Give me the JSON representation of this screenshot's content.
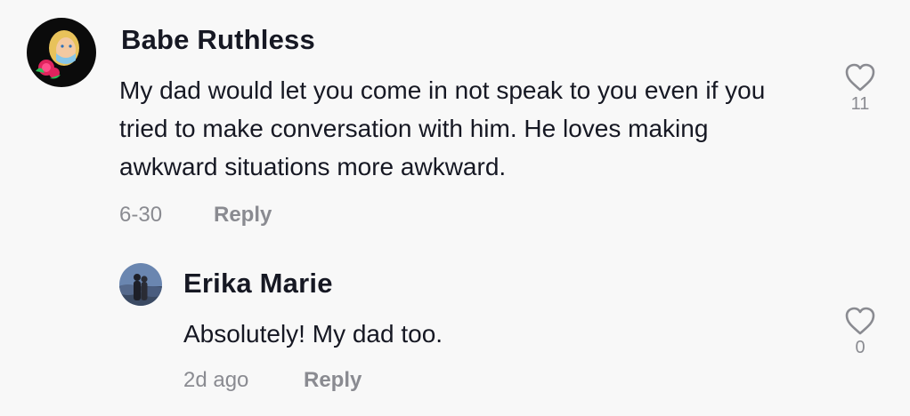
{
  "comments": [
    {
      "username": "Babe Ruthless",
      "text": "My dad would let you come in not speak to you even if you tried to make conversation with him. He loves making awkward situations more awkward.",
      "date": "6-30",
      "reply_label": "Reply",
      "like_count": "11"
    },
    {
      "username": "Erika Marie",
      "text": "Absolutely! My dad too.",
      "date": "2d ago",
      "reply_label": "Reply",
      "like_count": "0"
    }
  ],
  "colors": {
    "background": "#f8f8f8",
    "text_primary": "#161823",
    "text_secondary": "#8a8b91"
  },
  "icons": {
    "like": "heart-outline-icon"
  }
}
